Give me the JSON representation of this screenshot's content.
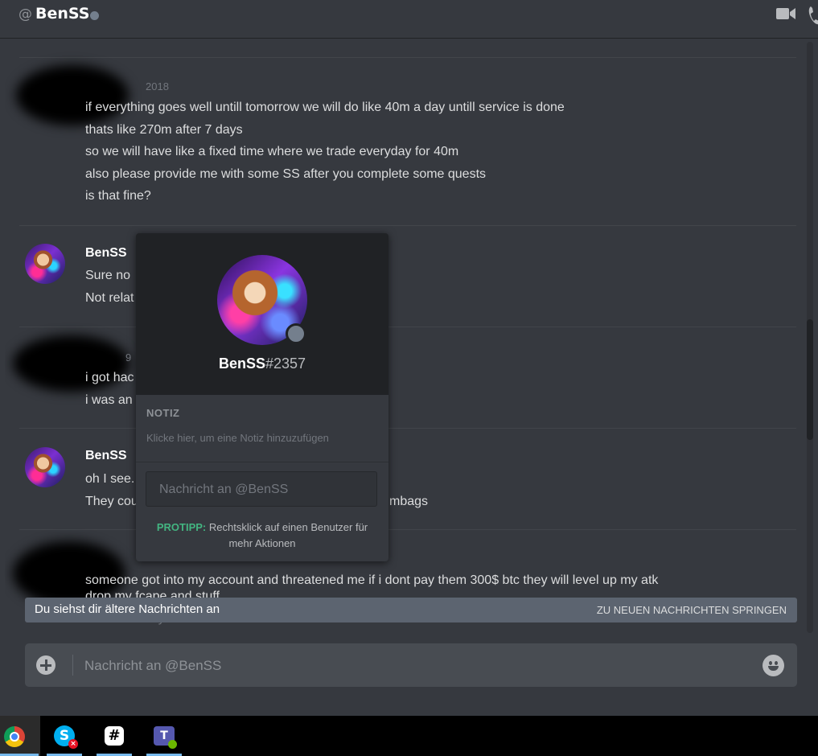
{
  "header": {
    "at_symbol": "@",
    "title": "BenSS",
    "status": "offline",
    "icons": [
      "video-call-icon",
      "phone-call-icon"
    ]
  },
  "messages": [
    {
      "author": "",
      "time": "2018",
      "lines": [
        "if everything goes well untill tomorrow we will do like 40m a day untill service is done",
        "thats like 270m after 7 days",
        "so we will have like a fixed time where we trade everyday for 40m",
        "also please provide me with some SS after you complete some quests",
        "is that fine?"
      ]
    },
    {
      "author": "BenSS",
      "time": "",
      "lines": [
        "Sure no",
        "Not relat"
      ]
    },
    {
      "author": "",
      "time": "9",
      "lines": [
        "i got hac",
        "i was an"
      ]
    },
    {
      "author": "BenSS",
      "time": "",
      "lines": [
        "oh I see.",
        "They cou",
        "mbags"
      ]
    },
    {
      "author": "",
      "time": "",
      "lines": [
        "someone got into my account and threatened me if i dont pay them 300$ btc they will level up my atk",
        "drop my fcape and stuff",
        "i didnt so they trained attack to lvl 4"
      ]
    }
  ],
  "older_bar": {
    "text": "Du siehst dir ältere Nachrichten an",
    "jump_label": "ZU NEUEN NACHRICHTEN SPRINGEN"
  },
  "composer": {
    "placeholder": "Nachricht an @BenSS"
  },
  "popout": {
    "username": "BenSS",
    "discriminator": "#2357",
    "note_header": "NOTIZ",
    "note_placeholder": "Klicke hier, um eine Notiz hinzuzufügen",
    "message_placeholder": "Nachricht an @BenSS",
    "protip_label": "PROTIPP:",
    "protip_text": "Rechtsklick auf einen Benutzer für mehr Aktionen"
  },
  "taskbar": {
    "apps": [
      "chrome-icon",
      "skype-icon",
      "slack-icon",
      "teams-icon"
    ]
  },
  "colors": {
    "background": "#36393f",
    "popout_top": "#202225",
    "protip_green": "#43b581",
    "status_offline": "#747f8d"
  }
}
